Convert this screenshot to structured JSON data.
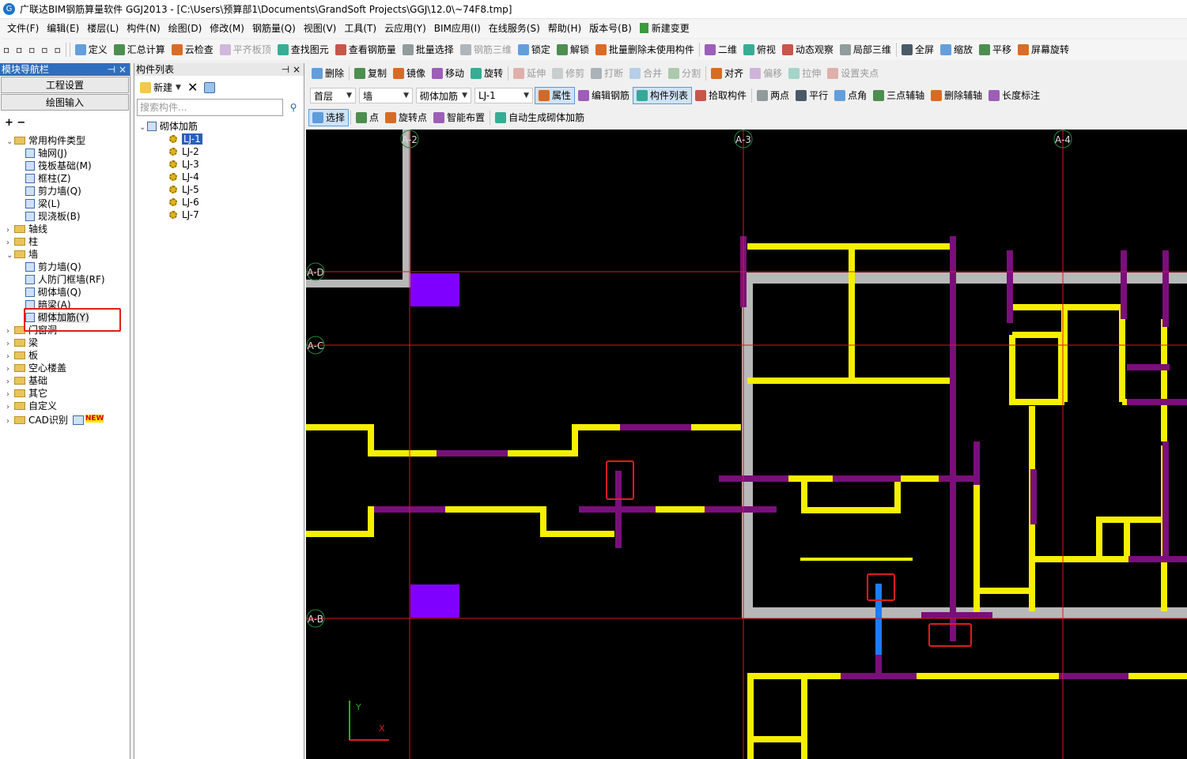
{
  "window": {
    "title": "广联达BIM钢筋算量软件 GGJ2013 - [C:\\Users\\预算部1\\Documents\\GrandSoft Projects\\GGJ\\12.0\\~74F8.tmp]"
  },
  "menu": [
    "文件(F)",
    "编辑(E)",
    "楼层(L)",
    "构件(N)",
    "绘图(D)",
    "修改(M)",
    "钢筋量(Q)",
    "视图(V)",
    "工具(T)",
    "云应用(Y)",
    "BIM应用(I)",
    "在线服务(S)",
    "帮助(H)",
    "版本号(B)",
    "新建变更"
  ],
  "toolbar1": [
    "定义",
    "汇总计算",
    "云检查",
    "平齐板顶",
    "查找图元",
    "查看钢筋量",
    "批量选择",
    "钢筋三维",
    "锁定",
    "解锁",
    "批量删除未使用构件",
    "二维",
    "俯视",
    "动态观察",
    "局部三维",
    "全屏",
    "缩放",
    "平移",
    "屏幕旋转"
  ],
  "toolbar2": [
    "删除",
    "复制",
    "镜像",
    "移动",
    "旋转",
    "延伸",
    "修剪",
    "打断",
    "合并",
    "分割",
    "对齐",
    "偏移",
    "拉伸",
    "设置夹点"
  ],
  "toolbar3": {
    "floor": "首层",
    "type": "墙",
    "subtype": "砌体加筋",
    "component": "LJ-1",
    "items": [
      "属性",
      "编辑钢筋",
      "构件列表",
      "拾取构件",
      "两点",
      "平行",
      "点角",
      "三点辅轴",
      "删除辅轴",
      "长度标注"
    ]
  },
  "toolbar4": [
    "选择",
    "点",
    "旋转点",
    "智能布置",
    "自动生成砌体加筋"
  ],
  "nav": {
    "title": "模块导航栏",
    "buttons": [
      "工程设置",
      "绘图输入"
    ],
    "tree": [
      {
        "label": "常用构件类型",
        "level": 0,
        "type": "folder",
        "open": true
      },
      {
        "label": "轴网(J)",
        "level": 1,
        "type": "leaf"
      },
      {
        "label": "筏板基础(M)",
        "level": 1,
        "type": "leaf"
      },
      {
        "label": "框柱(Z)",
        "level": 1,
        "type": "leaf"
      },
      {
        "label": "剪力墙(Q)",
        "level": 1,
        "type": "leaf"
      },
      {
        "label": "梁(L)",
        "level": 1,
        "type": "leaf"
      },
      {
        "label": "现浇板(B)",
        "level": 1,
        "type": "leaf"
      },
      {
        "label": "轴线",
        "level": 0,
        "type": "folder"
      },
      {
        "label": "柱",
        "level": 0,
        "type": "folder"
      },
      {
        "label": "墙",
        "level": 0,
        "type": "folder",
        "open": true
      },
      {
        "label": "剪力墙(Q)",
        "level": 1,
        "type": "leaf"
      },
      {
        "label": "人防门框墙(RF)",
        "level": 1,
        "type": "leaf"
      },
      {
        "label": "砌体墙(Q)",
        "level": 1,
        "type": "leaf"
      },
      {
        "label": "暗梁(A)",
        "level": 1,
        "type": "leaf"
      },
      {
        "label": "砌体加筋(Y)",
        "level": 1,
        "type": "leaf",
        "selected": true
      },
      {
        "label": "门窗洞",
        "level": 0,
        "type": "folder"
      },
      {
        "label": "梁",
        "level": 0,
        "type": "folder"
      },
      {
        "label": "板",
        "level": 0,
        "type": "folder"
      },
      {
        "label": "空心楼盖",
        "level": 0,
        "type": "folder"
      },
      {
        "label": "基础",
        "level": 0,
        "type": "folder"
      },
      {
        "label": "其它",
        "level": 0,
        "type": "folder"
      },
      {
        "label": "自定义",
        "level": 0,
        "type": "folder"
      },
      {
        "label": "CAD识别",
        "level": 0,
        "type": "folder",
        "badge": "NEW"
      }
    ]
  },
  "components": {
    "title": "构件列表",
    "new_label": "新建",
    "search_placeholder": "搜索构件...",
    "root": "砌体加筋",
    "items": [
      "LJ-1",
      "LJ-2",
      "LJ-3",
      "LJ-4",
      "LJ-5",
      "LJ-6",
      "LJ-7"
    ]
  },
  "axes": {
    "vertical": [
      "A-2",
      "A-3",
      "A-4"
    ],
    "horizontal": [
      "A-D",
      "A-C",
      "A-B"
    ]
  },
  "coord": {
    "y": "Y",
    "x": "X"
  },
  "colors": {
    "wall": "#f5f000",
    "rebar": "#7a0f7a",
    "column": "#8000ff",
    "selected": "#1e7bff",
    "axis": "#e01818",
    "grey": "#b8b8b8"
  }
}
